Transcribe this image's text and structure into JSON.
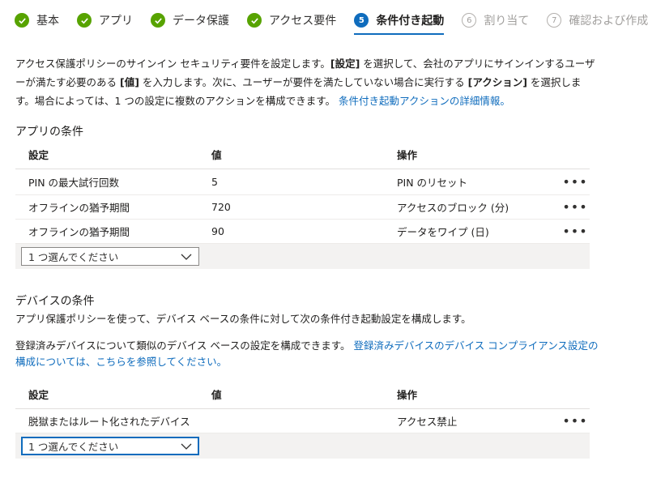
{
  "steps": [
    {
      "label": "基本",
      "state": "done"
    },
    {
      "label": "アプリ",
      "state": "done"
    },
    {
      "label": "データ保護",
      "state": "done"
    },
    {
      "label": "アクセス要件",
      "state": "done"
    },
    {
      "label": "条件付き起動",
      "state": "current",
      "num": "5"
    },
    {
      "label": "割り当て",
      "state": "todo",
      "num": "6"
    },
    {
      "label": "確認および作成",
      "state": "todo",
      "num": "7"
    }
  ],
  "intro": {
    "t1": "アクセス保護ポリシーのサインイン セキュリティ要件を設定します。",
    "b1": "[設定]",
    "t2": " を選択して、会社のアプリにサインインするユーザーが満たす必要のある ",
    "b2": "[値]",
    "t3": " を入力します。次に、ユーザーが要件を満たしていない場合に実行する ",
    "b3": "[アクション]",
    "t4": " を選択します。場合によっては、1 つの設定に複数のアクションを構成できます。 ",
    "link": "条件付き起動アクションの詳細情報。"
  },
  "app_conditions": {
    "title": "アプリの条件",
    "headers": {
      "setting": "設定",
      "value": "値",
      "action": "操作"
    },
    "rows": [
      {
        "setting": "PIN の最大試行回数",
        "value": "5",
        "action": "PIN のリセット"
      },
      {
        "setting": "オフラインの猶予期間",
        "value": "720",
        "action": "アクセスのブロック (分)"
      },
      {
        "setting": "オフラインの猶予期間",
        "value": "90",
        "action": "データをワイプ (日)"
      }
    ],
    "more": "•••",
    "dropdown": "1 つ選んでください"
  },
  "device_conditions": {
    "title": "デバイスの条件",
    "desc": "アプリ保護ポリシーを使って、デバイス ベースの条件に対して次の条件付き起動設定を構成します。",
    "desc2_text": "登録済みデバイスについて類似のデバイス ベースの設定を構成できます。 ",
    "desc2_link": "登録済みデバイスのデバイス コンプライアンス設定の構成については、こちらを参照してください。",
    "headers": {
      "setting": "設定",
      "value": "値",
      "action": "操作"
    },
    "rows": [
      {
        "setting": "脱獄またはルート化されたデバイス",
        "value": "",
        "action": "アクセス禁止"
      }
    ],
    "more": "•••",
    "dropdown": "1 つ選んでください"
  },
  "colors": {
    "accent": "#0f6cbd",
    "done": "#57a300"
  }
}
